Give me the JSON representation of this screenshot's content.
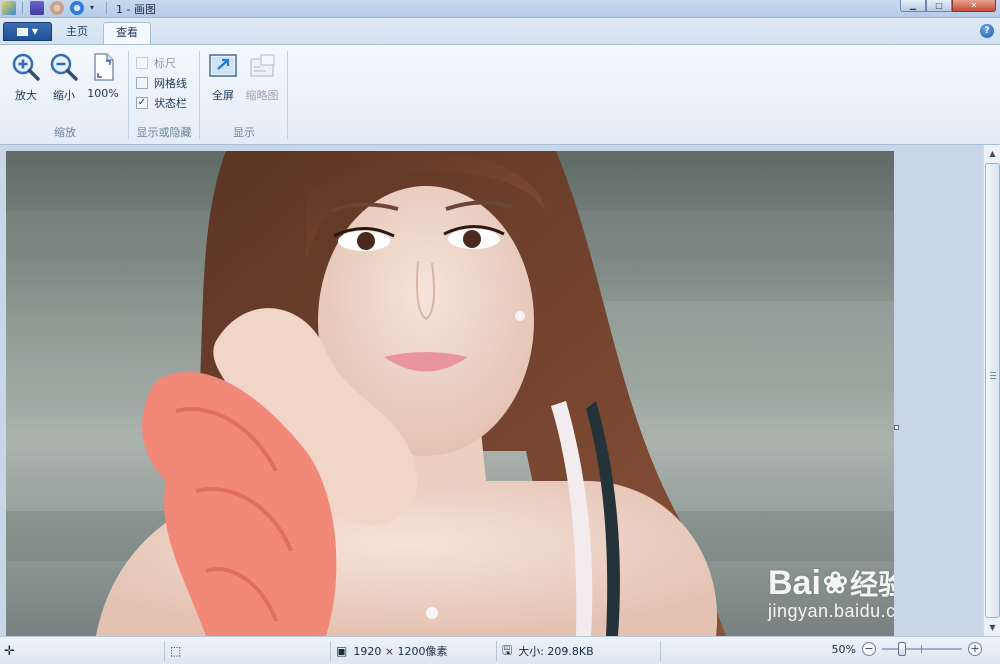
{
  "window": {
    "title": "1 - 画图",
    "controls": [
      "minimize",
      "maximize",
      "close"
    ]
  },
  "tabs": [
    {
      "label": "主页",
      "active": false
    },
    {
      "label": "查看",
      "active": true
    }
  ],
  "ribbon": {
    "zoom_group": {
      "label": "缩放",
      "buttons": [
        {
          "label": "放大",
          "icon": "zoom-in-icon"
        },
        {
          "label": "缩小",
          "icon": "zoom-out-icon"
        },
        {
          "label": "100%",
          "icon": "actual-size-icon"
        }
      ]
    },
    "show_hide_group": {
      "label": "显示或隐藏",
      "items": [
        {
          "label": "标尺",
          "checked": false,
          "enabled": false
        },
        {
          "label": "网格线",
          "checked": false,
          "enabled": true
        },
        {
          "label": "状态栏",
          "checked": true,
          "enabled": true
        }
      ]
    },
    "display_group": {
      "label": "显示",
      "buttons": [
        {
          "label": "全屏",
          "icon": "fullscreen-icon",
          "enabled": true
        },
        {
          "label": "缩略图",
          "icon": "thumbnail-icon",
          "enabled": false
        }
      ]
    }
  },
  "statusbar": {
    "dimensions": "1920 × 1200像素",
    "file_size": "大小: 209.8KB",
    "zoom_level": "50%",
    "zoom_fraction": 0.5
  },
  "watermark": {
    "main": "Bai",
    "brand_cn": "经验",
    "sub": "jingyan.baidu.com"
  },
  "colors": {
    "accent": "#1f4f98",
    "ribbon_bg": "#e4ecf7",
    "canvas_bg": "#c9d6e7"
  }
}
